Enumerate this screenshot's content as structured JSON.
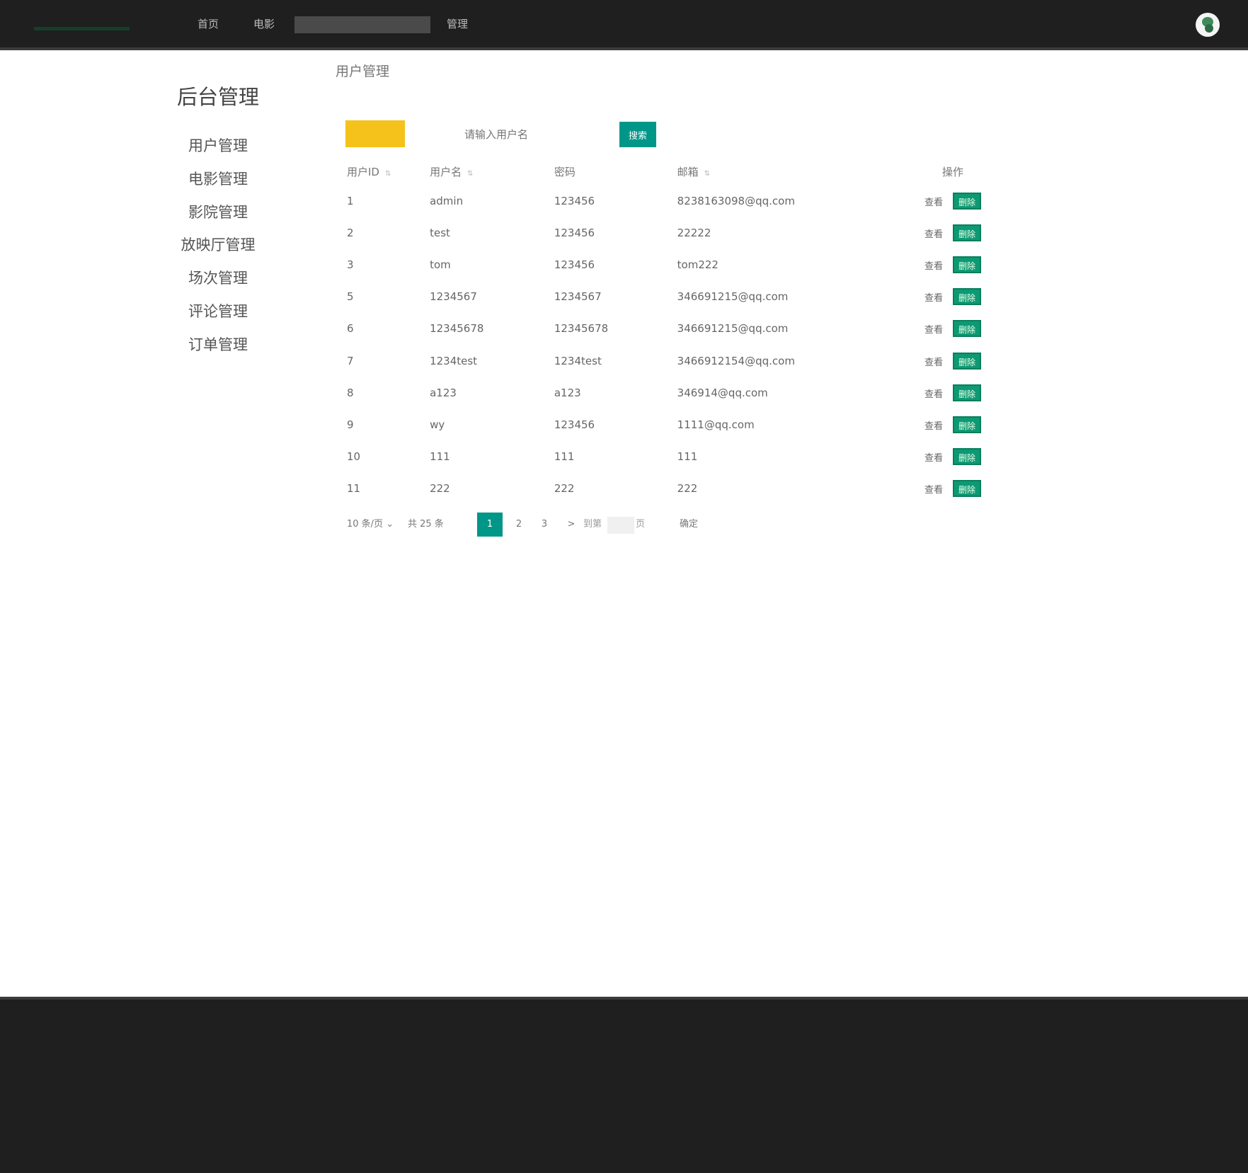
{
  "header": {
    "logo": "",
    "nav": [
      {
        "label": "首页"
      },
      {
        "label": "电影"
      },
      {
        "label": "管理"
      }
    ],
    "search_placeholder": ""
  },
  "sidebar": {
    "title": "后台管理",
    "items": [
      {
        "label": "用户管理"
      },
      {
        "label": "电影管理"
      },
      {
        "label": "影院管理"
      },
      {
        "label": "放映厅管理"
      },
      {
        "label": "场次管理"
      },
      {
        "label": "评论管理"
      },
      {
        "label": "订单管理"
      }
    ]
  },
  "main": {
    "breadcrumb": "用户管理",
    "add_label": "",
    "search_placeholder": "请输入用户名",
    "search_label": "搜索",
    "columns": [
      "用户ID",
      "用户名",
      "密码",
      "邮箱",
      "操作"
    ],
    "rows": [
      {
        "id": "1",
        "name": "admin",
        "pwd": "123456",
        "email": "8238163098@qq.com"
      },
      {
        "id": "2",
        "name": "test",
        "pwd": "123456",
        "email": "22222"
      },
      {
        "id": "3",
        "name": "tom",
        "pwd": "123456",
        "email": "tom222"
      },
      {
        "id": "5",
        "name": "1234567",
        "pwd": "1234567",
        "email": "346691215@qq.com"
      },
      {
        "id": "6",
        "name": "12345678",
        "pwd": "12345678",
        "email": "346691215@qq.com"
      },
      {
        "id": "7",
        "name": "1234test",
        "pwd": "1234test",
        "email": "3466912154@qq.com"
      },
      {
        "id": "8",
        "name": "a123",
        "pwd": "a123",
        "email": "346914@qq.com"
      },
      {
        "id": "9",
        "name": "wy",
        "pwd": "123456",
        "email": "1111@qq.com"
      },
      {
        "id": "10",
        "name": "111",
        "pwd": "111",
        "email": "111"
      },
      {
        "id": "11",
        "name": "222",
        "pwd": "222",
        "email": "222"
      }
    ],
    "view_label": "查看",
    "delete_label": "删除"
  },
  "pager": {
    "page_size": "10 条/页",
    "total": "共 25 条",
    "current": "1",
    "pages": [
      "2",
      "3"
    ],
    "next": ">",
    "goto_label": "到第",
    "goto_suffix": "页",
    "ok_label": "确定"
  },
  "footer": {
    "text": ""
  },
  "colors": {
    "header_bg": "#1f1f1f",
    "primary": "#009688",
    "add_button": "#f5c21b",
    "delete_button": "#0d9a72"
  }
}
